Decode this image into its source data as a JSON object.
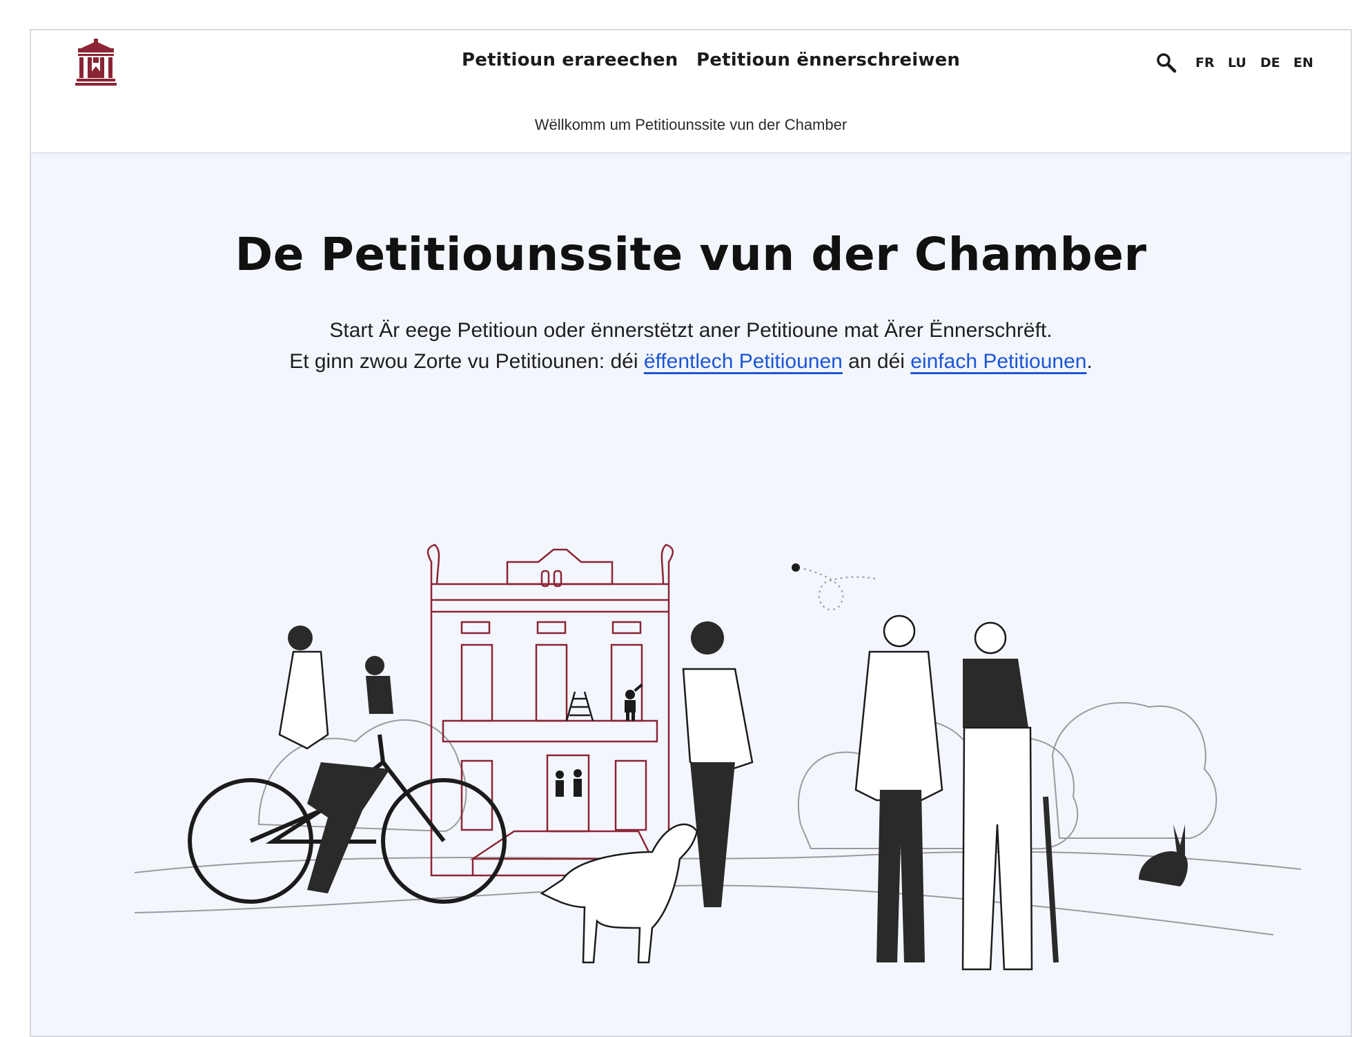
{
  "header": {
    "logo_alt": "Chamber of Deputies logo",
    "nav": [
      {
        "label": "Petitioun erareechen"
      },
      {
        "label": "Petitioun ënnerschreiwen"
      }
    ],
    "search_icon": "search-icon",
    "languages": [
      "FR",
      "LU",
      "DE",
      "EN"
    ]
  },
  "subheader": {
    "welcome": "Wëllkomm um Petitiounssite vun der Chamber"
  },
  "hero": {
    "title": "De Petitiounssite vun der Chamber",
    "line1": "Start Är eege Petitioun oder ënnerstëtzt aner Petitioune mat Ärer Ënnerschrëft.",
    "line2_prefix": "Et ginn zwou Zorte vu Petitiounen: déi ",
    "link_public": "ëffentlech Petitiounen",
    "line2_middle": " an déi ",
    "link_simple": "einfach Petitiounen",
    "line2_suffix": "."
  },
  "colors": {
    "brand": "#8b2434",
    "link": "#1a56d6",
    "hero_bg": "#f3f6fd"
  }
}
